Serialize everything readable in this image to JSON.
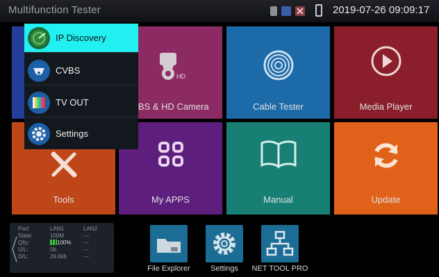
{
  "status_bar": {
    "title": "Multifunction Tester",
    "datetime": "2019-07-26 09:09:17",
    "icons": [
      "sd-card-icon",
      "tf-card-icon",
      "network-disconnected-icon",
      "battery-icon"
    ]
  },
  "tiles": [
    {
      "id": "ipc",
      "label": "",
      "icon": "ip-camera-icon",
      "color": "#243f9a"
    },
    {
      "id": "cvbs-hd",
      "label": "VBS & HD Camera",
      "icon": "hd-camera-icon",
      "color": "#8b2a63"
    },
    {
      "id": "cable",
      "label": "Cable Tester",
      "icon": "cable-icon",
      "color": "#1d6aa9"
    },
    {
      "id": "media",
      "label": "Media Player",
      "icon": "play-icon",
      "color": "#8b1e2b"
    },
    {
      "id": "tools",
      "label": "Tools",
      "icon": "tools-icon",
      "color": "#bf4618"
    },
    {
      "id": "myapps",
      "label": "My APPS",
      "icon": "apps-icon",
      "color": "#5e1e7e"
    },
    {
      "id": "manual",
      "label": "Manual",
      "icon": "book-icon",
      "color": "#187f74"
    },
    {
      "id": "update",
      "label": "Update",
      "icon": "refresh-icon",
      "color": "#e0621a"
    }
  ],
  "menu": {
    "items": [
      {
        "label": "IP Discovery",
        "icon": "radar-icon",
        "selected": true
      },
      {
        "label": "CVBS",
        "icon": "dome-camera-icon",
        "selected": false
      },
      {
        "label": "TV OUT",
        "icon": "color-bars-icon",
        "selected": false
      },
      {
        "label": "Settings",
        "icon": "gear-icon",
        "selected": false
      }
    ]
  },
  "network_panel": {
    "labels": [
      "Port:",
      "State:",
      "Qlty:",
      "U/L:",
      "D/L:"
    ],
    "lan1": {
      "header": "LAN1",
      "state": "100M",
      "quality": "100%",
      "upload": "0b",
      "download": "26.6kb"
    },
    "lan2": {
      "header": "LAN2",
      "state": "---",
      "quality": "---",
      "upload": "---",
      "download": "---"
    }
  },
  "dock": [
    {
      "label": "File Explorer",
      "icon": "folder-icon"
    },
    {
      "label": "Settings",
      "icon": "gear-icon"
    },
    {
      "label": "NET TOOL PRO",
      "icon": "network-icon"
    }
  ],
  "colors": {
    "menu_highlight": "#22f0f0",
    "menu_bg": "#13171e",
    "dock_tile": "#1c6d96"
  }
}
